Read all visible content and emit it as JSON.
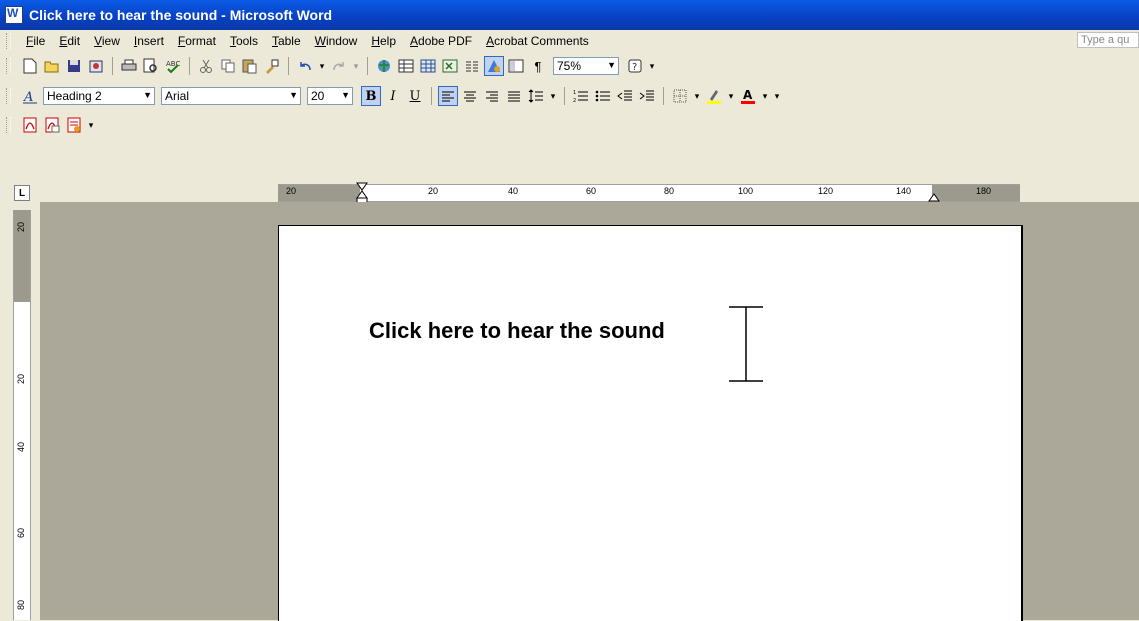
{
  "window": {
    "title": "Click here to hear the sound - Microsoft Word"
  },
  "menu": {
    "items": [
      "File",
      "Edit",
      "View",
      "Insert",
      "Format",
      "Tools",
      "Table",
      "Window",
      "Help",
      "Adobe PDF",
      "Acrobat Comments"
    ],
    "ask_placeholder": "Type a qu"
  },
  "standard_toolbar": {
    "zoom": "75%"
  },
  "formatting_toolbar": {
    "style": "Heading 2",
    "font": "Arial",
    "size": "20"
  },
  "ruler": {
    "h_labels": [
      "20",
      "20",
      "40",
      "60",
      "80",
      "100",
      "120",
      "140",
      "180"
    ],
    "v_labels": [
      "20",
      "20",
      "40",
      "60",
      "80"
    ]
  },
  "document": {
    "heading_text": "Click here to hear the sound"
  },
  "icons": {
    "new": "new-document-icon",
    "open": "open-folder-icon",
    "save": "save-disk-icon",
    "print": "printer-icon",
    "preview": "print-preview-icon",
    "spell": "spelling-icon",
    "cut": "scissors-icon",
    "copy": "copy-icon",
    "paste": "paste-icon",
    "format_painter": "brush-icon",
    "undo": "undo-icon",
    "redo": "redo-icon",
    "hyperlink": "globe-link-icon",
    "tables": "table-icon",
    "insert_table": "insert-table-icon",
    "excel": "excel-icon",
    "columns": "columns-icon",
    "drawing": "drawing-icon",
    "doc_map": "document-map-icon",
    "pilcrow": "pilcrow-icon",
    "help": "help-icon"
  },
  "colors": {
    "title_bar": "#0a5be6",
    "highlight": "#ffff00",
    "font_color": "#ff0000"
  }
}
